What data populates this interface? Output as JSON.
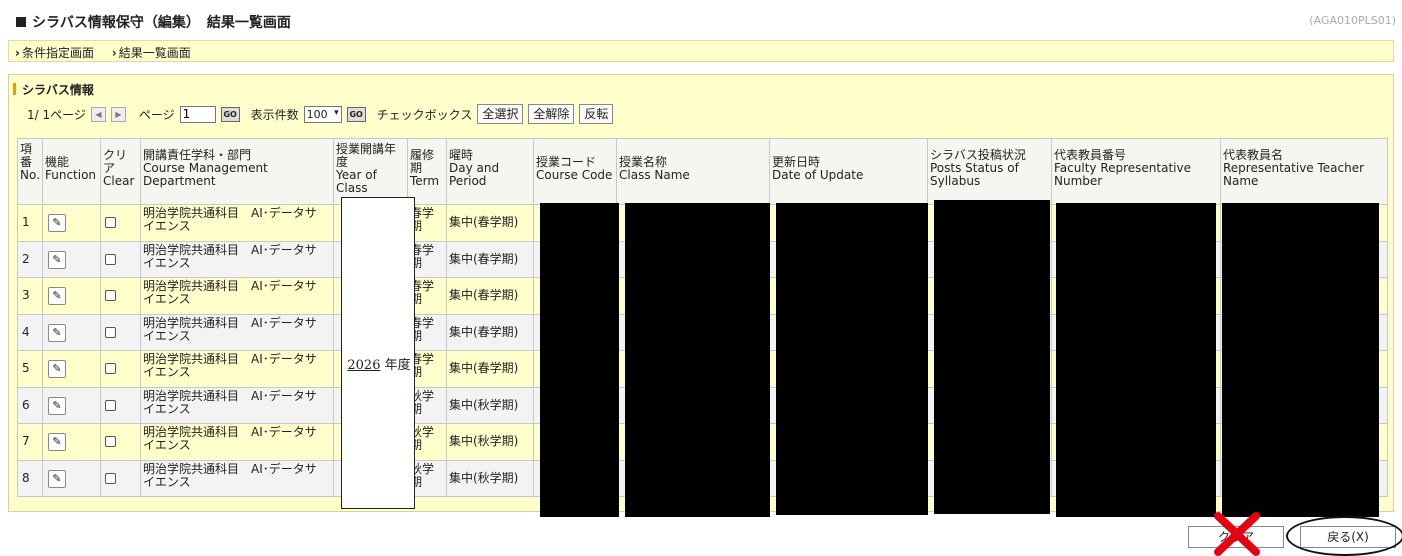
{
  "header": {
    "title": "シラバス情報保守（編集）　結果一覧画面",
    "screen_id": "(AGA010PLS01)"
  },
  "breadcrumb": {
    "items": [
      "条件指定画面",
      "結果一覧画面"
    ]
  },
  "section": {
    "title": "シラバス情報"
  },
  "pager": {
    "page_info": "1/ 1ページ",
    "page_label": "ページ",
    "page_value": "1",
    "go_label": "GO",
    "count_label": "表示件数",
    "count_value": "100",
    "checkbox_label": "チェックボックス",
    "select_all": "全選択",
    "clear_all": "全解除",
    "invert": "反転"
  },
  "table": {
    "headers": {
      "no": [
        "項",
        "番",
        "No."
      ],
      "function": [
        "機能",
        "Function"
      ],
      "clear": [
        "クリ",
        "ア",
        "Clear"
      ],
      "dept": [
        "開講責任学科・部門",
        "Course Management",
        "Department"
      ],
      "year": [
        "授業開講年",
        "度",
        "Year of",
        "Class"
      ],
      "term": [
        "履修",
        "期",
        "Term"
      ],
      "period": [
        "曜時",
        "Day and",
        "Period"
      ],
      "code": [
        "授業コード",
        "Course Code"
      ],
      "classname": [
        "授業名称",
        "Class Name"
      ],
      "updated": [
        "更新日時",
        "Date of Update"
      ],
      "status": [
        "シラバス投稿状況",
        "Posts Status of",
        "Syllabus"
      ],
      "faculty_no": [
        "代表教員番号",
        "Faculty Representative",
        "Number"
      ],
      "teacher": [
        "代表教員名",
        "Representative Teacher",
        "Name"
      ]
    },
    "rows": [
      {
        "no": "1",
        "dept": [
          "明治学院共通科目　AI･データサ",
          "イエンス"
        ],
        "term": [
          "春学",
          "期"
        ],
        "period": "集中(春学期)"
      },
      {
        "no": "2",
        "dept": [
          "明治学院共通科目　AI･データサ",
          "イエンス"
        ],
        "term": [
          "春学",
          "期"
        ],
        "period": "集中(春学期)"
      },
      {
        "no": "3",
        "dept": [
          "明治学院共通科目　AI･データサ",
          "イエンス"
        ],
        "term": [
          "春学",
          "期"
        ],
        "period": "集中(春学期)"
      },
      {
        "no": "4",
        "dept": [
          "明治学院共通科目　AI･データサ",
          "イエンス"
        ],
        "term": [
          "春学",
          "期"
        ],
        "period": "集中(春学期)"
      },
      {
        "no": "5",
        "dept": [
          "明治学院共通科目　AI･データサ",
          "イエンス"
        ],
        "term": [
          "春学",
          "期"
        ],
        "period": "集中(春学期)"
      },
      {
        "no": "6",
        "dept": [
          "明治学院共通科目　AI･データサ",
          "イエンス"
        ],
        "term": [
          "秋学",
          "期"
        ],
        "period": "集中(秋学期)"
      },
      {
        "no": "7",
        "dept": [
          "明治学院共通科目　AI･データサ",
          "イエンス"
        ],
        "term": [
          "秋学",
          "期"
        ],
        "period": "集中(秋学期)"
      },
      {
        "no": "8",
        "dept": [
          "明治学院共通科目　AI･データサ",
          "イエンス"
        ],
        "term": [
          "秋学",
          "期"
        ],
        "period": "集中(秋学期)"
      }
    ],
    "year_value": "2026",
    "year_suffix": " 年度"
  },
  "footer": {
    "clear_label": "クリア",
    "back_label": "戻る(X)"
  },
  "colors": {
    "panel_bg": "#ffffcc",
    "row_even": "#f3f3f3",
    "accent": "#f39800",
    "annotation_red": "#e60012"
  },
  "icons": {
    "edit": "pencil-icon",
    "prev": "triangle-left-icon",
    "next": "triangle-right-icon"
  }
}
